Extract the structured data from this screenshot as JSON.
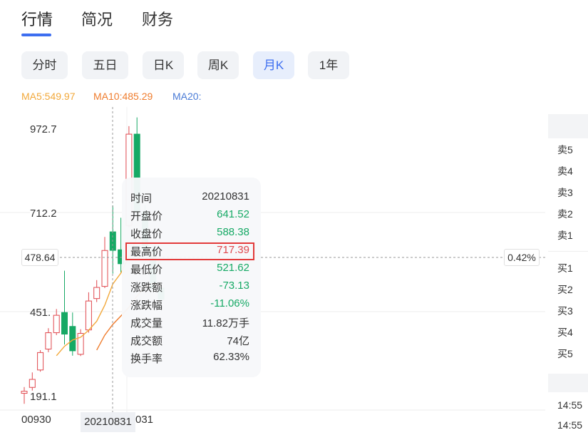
{
  "tabs": [
    {
      "label": "行情",
      "active": true
    },
    {
      "label": "简况",
      "active": false
    },
    {
      "label": "财务",
      "active": false
    }
  ],
  "periods": [
    {
      "label": "分时",
      "active": false
    },
    {
      "label": "五日",
      "active": false
    },
    {
      "label": "日K",
      "active": false
    },
    {
      "label": "周K",
      "active": false
    },
    {
      "label": "月K",
      "active": true
    },
    {
      "label": "1年",
      "active": false
    }
  ],
  "ma": {
    "ma5": "MA5:549.97",
    "ma10": "MA10:485.29",
    "ma20": "MA20:"
  },
  "colors": {
    "accent": "#3d6ef0",
    "up": "#e0484e",
    "down": "#16a965",
    "ma5": "#f2a83a",
    "ma10": "#ef7c2d",
    "ma20": "#4a7bd6",
    "highlight_border": "#e23a3a"
  },
  "y_axis": {
    "labels": [
      "972.7",
      "712.2",
      "451.",
      "191.1"
    ],
    "current_price": "478.64",
    "current_pct": "0.42%"
  },
  "x_axis": {
    "left": "00930",
    "hover": "20210831",
    "right": "031"
  },
  "chart_data": {
    "type": "candlestick",
    "candles": [
      {
        "o": 178,
        "c": 184,
        "h": 196,
        "l": 148
      },
      {
        "o": 195,
        "c": 218,
        "h": 238,
        "l": 186
      },
      {
        "o": 245,
        "c": 295,
        "h": 302,
        "l": 240
      },
      {
        "o": 305,
        "c": 352,
        "h": 365,
        "l": 296
      },
      {
        "o": 352,
        "c": 402,
        "h": 420,
        "l": 345
      },
      {
        "o": 410,
        "c": 348,
        "h": 530,
        "l": 318
      },
      {
        "o": 370,
        "c": 300,
        "h": 410,
        "l": 286
      },
      {
        "o": 290,
        "c": 350,
        "h": 362,
        "l": 285
      },
      {
        "o": 360,
        "c": 443,
        "h": 468,
        "l": 352
      },
      {
        "o": 450,
        "c": 482,
        "h": 503,
        "l": 440
      },
      {
        "o": 485,
        "c": 588,
        "h": 627,
        "l": 480
      },
      {
        "o": 641.52,
        "c": 588.38,
        "h": 717.39,
        "l": 521.62
      },
      {
        "o": 590,
        "c": 550,
        "h": 682,
        "l": 525
      },
      {
        "o": 660,
        "c": 922,
        "h": 945,
        "l": 654
      },
      {
        "o": 922,
        "c": 700,
        "h": 970,
        "l": 690
      },
      {
        "o": 700,
        "c": 590,
        "h": 718,
        "l": 575
      },
      {
        "o": 590,
        "c": 480,
        "h": 600,
        "l": 470
      },
      {
        "o": 480,
        "c": 448,
        "h": 490,
        "l": 440
      }
    ],
    "ma5": [
      null,
      null,
      null,
      null,
      286,
      313,
      331,
      339,
      359,
      385,
      431,
      492,
      523,
      570,
      626,
      611,
      569,
      549.97
    ],
    "ma10": [
      null,
      null,
      null,
      null,
      null,
      null,
      null,
      null,
      null,
      302,
      345,
      376,
      400,
      425,
      457,
      484,
      494,
      485.29
    ],
    "ylim": [
      130,
      1000
    ]
  },
  "tooltip": {
    "rows": [
      {
        "label": "时间",
        "value": "20210831",
        "color": "#333333"
      },
      {
        "label": "开盘价",
        "value": "641.52",
        "color": "#16a965"
      },
      {
        "label": "收盘价",
        "value": "588.38",
        "color": "#16a965"
      },
      {
        "label": "最高价",
        "value": "717.39",
        "color": "#e0484e"
      },
      {
        "label": "最低价",
        "value": "521.62",
        "color": "#16a965"
      },
      {
        "label": "涨跌额",
        "value": "-73.13",
        "color": "#16a965"
      },
      {
        "label": "涨跌幅",
        "value": "-11.06%",
        "color": "#16a965"
      },
      {
        "label": "成交量",
        "value": "11.82万手",
        "color": "#333333"
      },
      {
        "label": "成交额",
        "value": "74亿",
        "color": "#333333"
      },
      {
        "label": "换手率",
        "value": "62.33%",
        "color": "#333333"
      }
    ]
  },
  "orderbook": {
    "sell": [
      "卖5",
      "卖4",
      "卖3",
      "卖2",
      "卖1"
    ],
    "buy": [
      "买1",
      "买2",
      "买3",
      "买4",
      "买5"
    ],
    "times": [
      "14:55",
      "14:55"
    ]
  }
}
